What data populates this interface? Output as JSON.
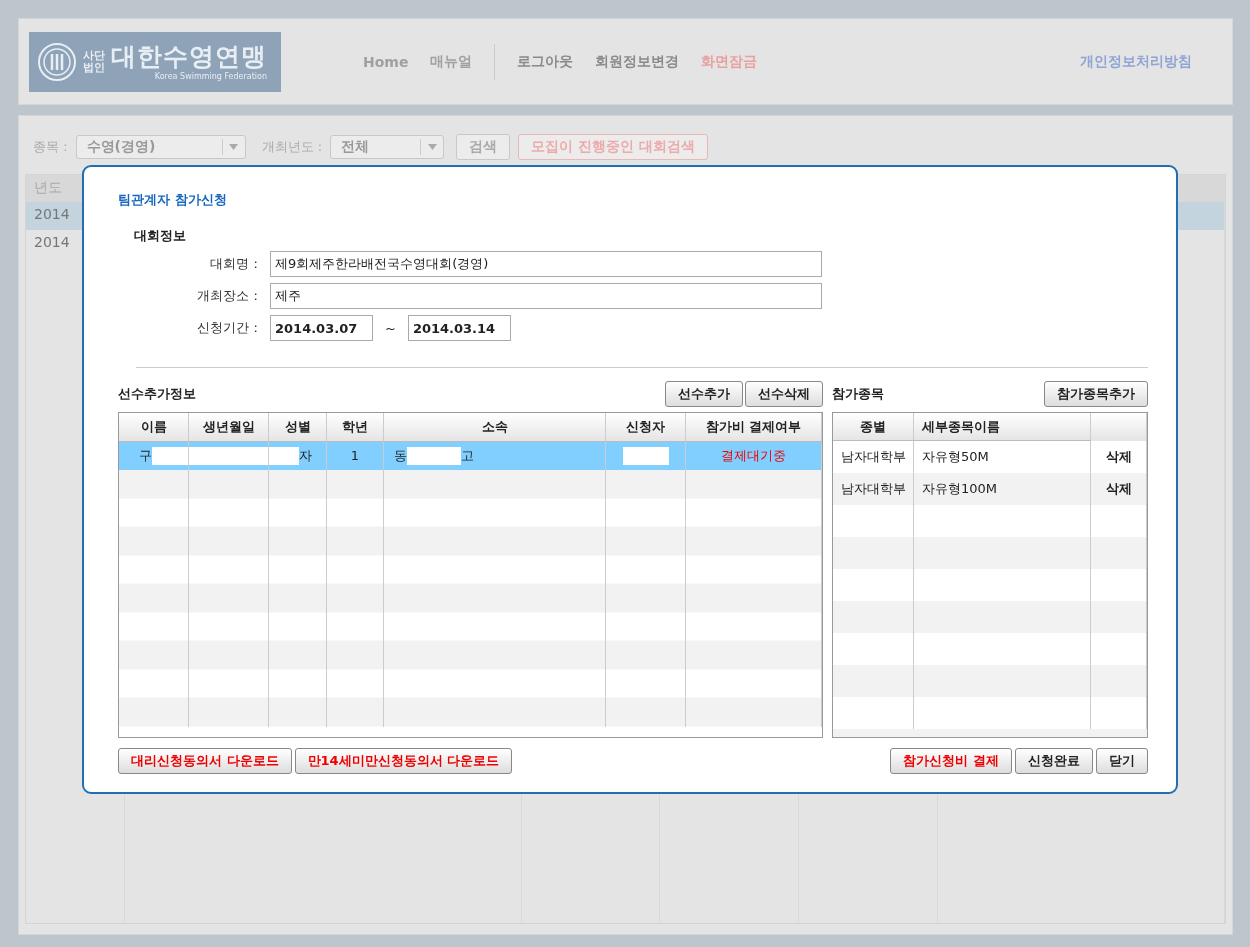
{
  "header": {
    "logo": {
      "prefix_top": "사단",
      "prefix_bottom": "법인",
      "title": "대한수영연맹",
      "subtitle": "Korea Swimming Federation"
    },
    "nav_groups": [
      [
        {
          "label": "Home",
          "kind": "muted"
        },
        {
          "label": "매뉴얼",
          "kind": "muted"
        }
      ],
      [
        {
          "label": "로그아웃",
          "kind": "normal"
        },
        {
          "label": "회원정보변경",
          "kind": "normal"
        },
        {
          "label": "화면잠금",
          "kind": "alert"
        }
      ]
    ],
    "privacy_link": "개인정보처리방침"
  },
  "filter": {
    "event_label": "종목 :",
    "event_value": "수영(경영)",
    "year_label": "개최년도 :",
    "year_value": "전체",
    "search_button": "검색",
    "recruiting_button": "모집이 진행중인 대회검색"
  },
  "competition_table": {
    "columns": [
      "년도"
    ],
    "rows": [
      {
        "year": "2014",
        "selected": true
      },
      {
        "year": "2014",
        "selected": false
      }
    ]
  },
  "dialog": {
    "title": "팀관계자 참가신청",
    "section_title": "대회정보",
    "fields": [
      {
        "label": "대회명 :",
        "value": "제9회제주한라배전국수영대회(경영)"
      },
      {
        "label": "개최장소 :",
        "value": "제주"
      }
    ],
    "period": {
      "label": "신청기간 :",
      "start": "2014.03.07",
      "separator": "~",
      "end": "2014.03.14"
    },
    "players": {
      "title": "선수추가정보",
      "buttons": [
        "선수추가",
        "선수삭제"
      ],
      "columns": [
        "이름",
        "생년월일",
        "성별",
        "학년",
        "소속",
        "신청자",
        "참가비 결제여부"
      ],
      "rows": [
        {
          "name": "구",
          "gender": "자",
          "grade": "1",
          "school_start": "동",
          "school_end": "고",
          "payment_status": "결제대기중",
          "redacted": true,
          "selected": true
        }
      ]
    },
    "events": {
      "title": "참가종목",
      "button": "참가종목추가",
      "columns": [
        "종별",
        "세부종목이름"
      ],
      "rows": [
        {
          "group": "남자대학부",
          "event": "자유형50M",
          "action": "삭제"
        },
        {
          "group": "남자대학부",
          "event": "자유형100M",
          "action": "삭제"
        }
      ]
    },
    "left_buttons": [
      "대리신청동의서 다운로드",
      "만14세미만신청동의서 다운로드"
    ],
    "right_buttons": [
      {
        "label": "참가신청비 결제",
        "kind": "alert"
      },
      {
        "label": "신청완료",
        "kind": "normal"
      },
      {
        "label": "닫기",
        "kind": "normal"
      }
    ]
  }
}
